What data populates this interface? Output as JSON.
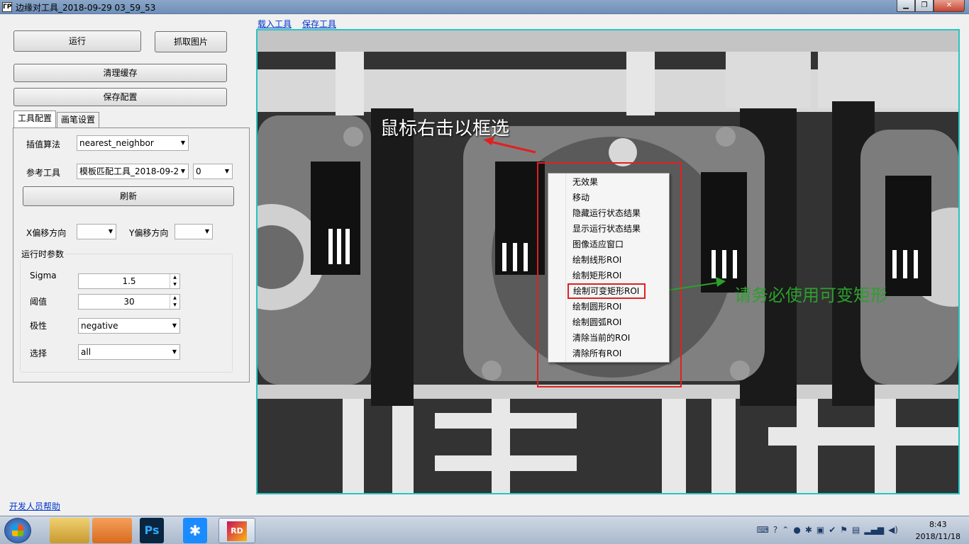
{
  "window": {
    "title": "边缘对工具_2018-09-29 03_59_53",
    "app_icon": "ΓP"
  },
  "toolbar": {
    "run": "运行",
    "capture": "抓取图片",
    "clear_cache": "清理缓存",
    "save_config": "保存配置"
  },
  "tabs": [
    "工具配置",
    "画笔设置"
  ],
  "config": {
    "interp_label": "插值算法",
    "interp_value": "nearest_neighbor",
    "ref_label": "参考工具",
    "ref_value": "模板匹配工具_2018-09-2",
    "ref_index": "0",
    "refresh": "刷新",
    "x_offset_label": "X偏移方向",
    "x_offset_value": "",
    "y_offset_label": "Y偏移方向",
    "y_offset_value": ""
  },
  "runtime": {
    "group_title": "运行时参数",
    "sigma_label": "Sigma",
    "sigma_value": "1.5",
    "threshold_label": "阈值",
    "threshold_value": "30",
    "polarity_label": "极性",
    "polarity_value": "negative",
    "select_label": "选择",
    "select_value": "all"
  },
  "links": {
    "load_tool": "载入工具",
    "save_tool": "保存工具",
    "dev_help": "开发人员帮助"
  },
  "annotations": {
    "right_click_hint": "鼠标右击以框选",
    "use_variable_rect": "请务必使用可变矩形"
  },
  "context_menu": [
    "无效果",
    "移动",
    "隐藏运行状态结果",
    "显示运行状态结果",
    "图像适应窗口",
    "绘制线形ROI",
    "绘制矩形ROI",
    "绘制可变矩形ROI",
    "绘制圆形ROI",
    "绘制圆弧ROI",
    "清除当前的ROI",
    "清除所有ROI"
  ],
  "taskbar": {
    "apps": [
      {
        "icon": "explorer-icon"
      },
      {
        "icon": "media-player-icon"
      },
      {
        "icon": "photoshop-icon",
        "label": "Ps"
      },
      {
        "icon": "app-star-icon",
        "label": "✱"
      },
      {
        "icon": "rider-icon",
        "label": "RD"
      }
    ],
    "time": "8:43",
    "date": "2018/11/18"
  },
  "colors": {
    "viewer_border": "#27c4c4",
    "highlight_red": "#e02020",
    "annotation_green": "#2ca02c",
    "link_blue": "#0033cc"
  }
}
